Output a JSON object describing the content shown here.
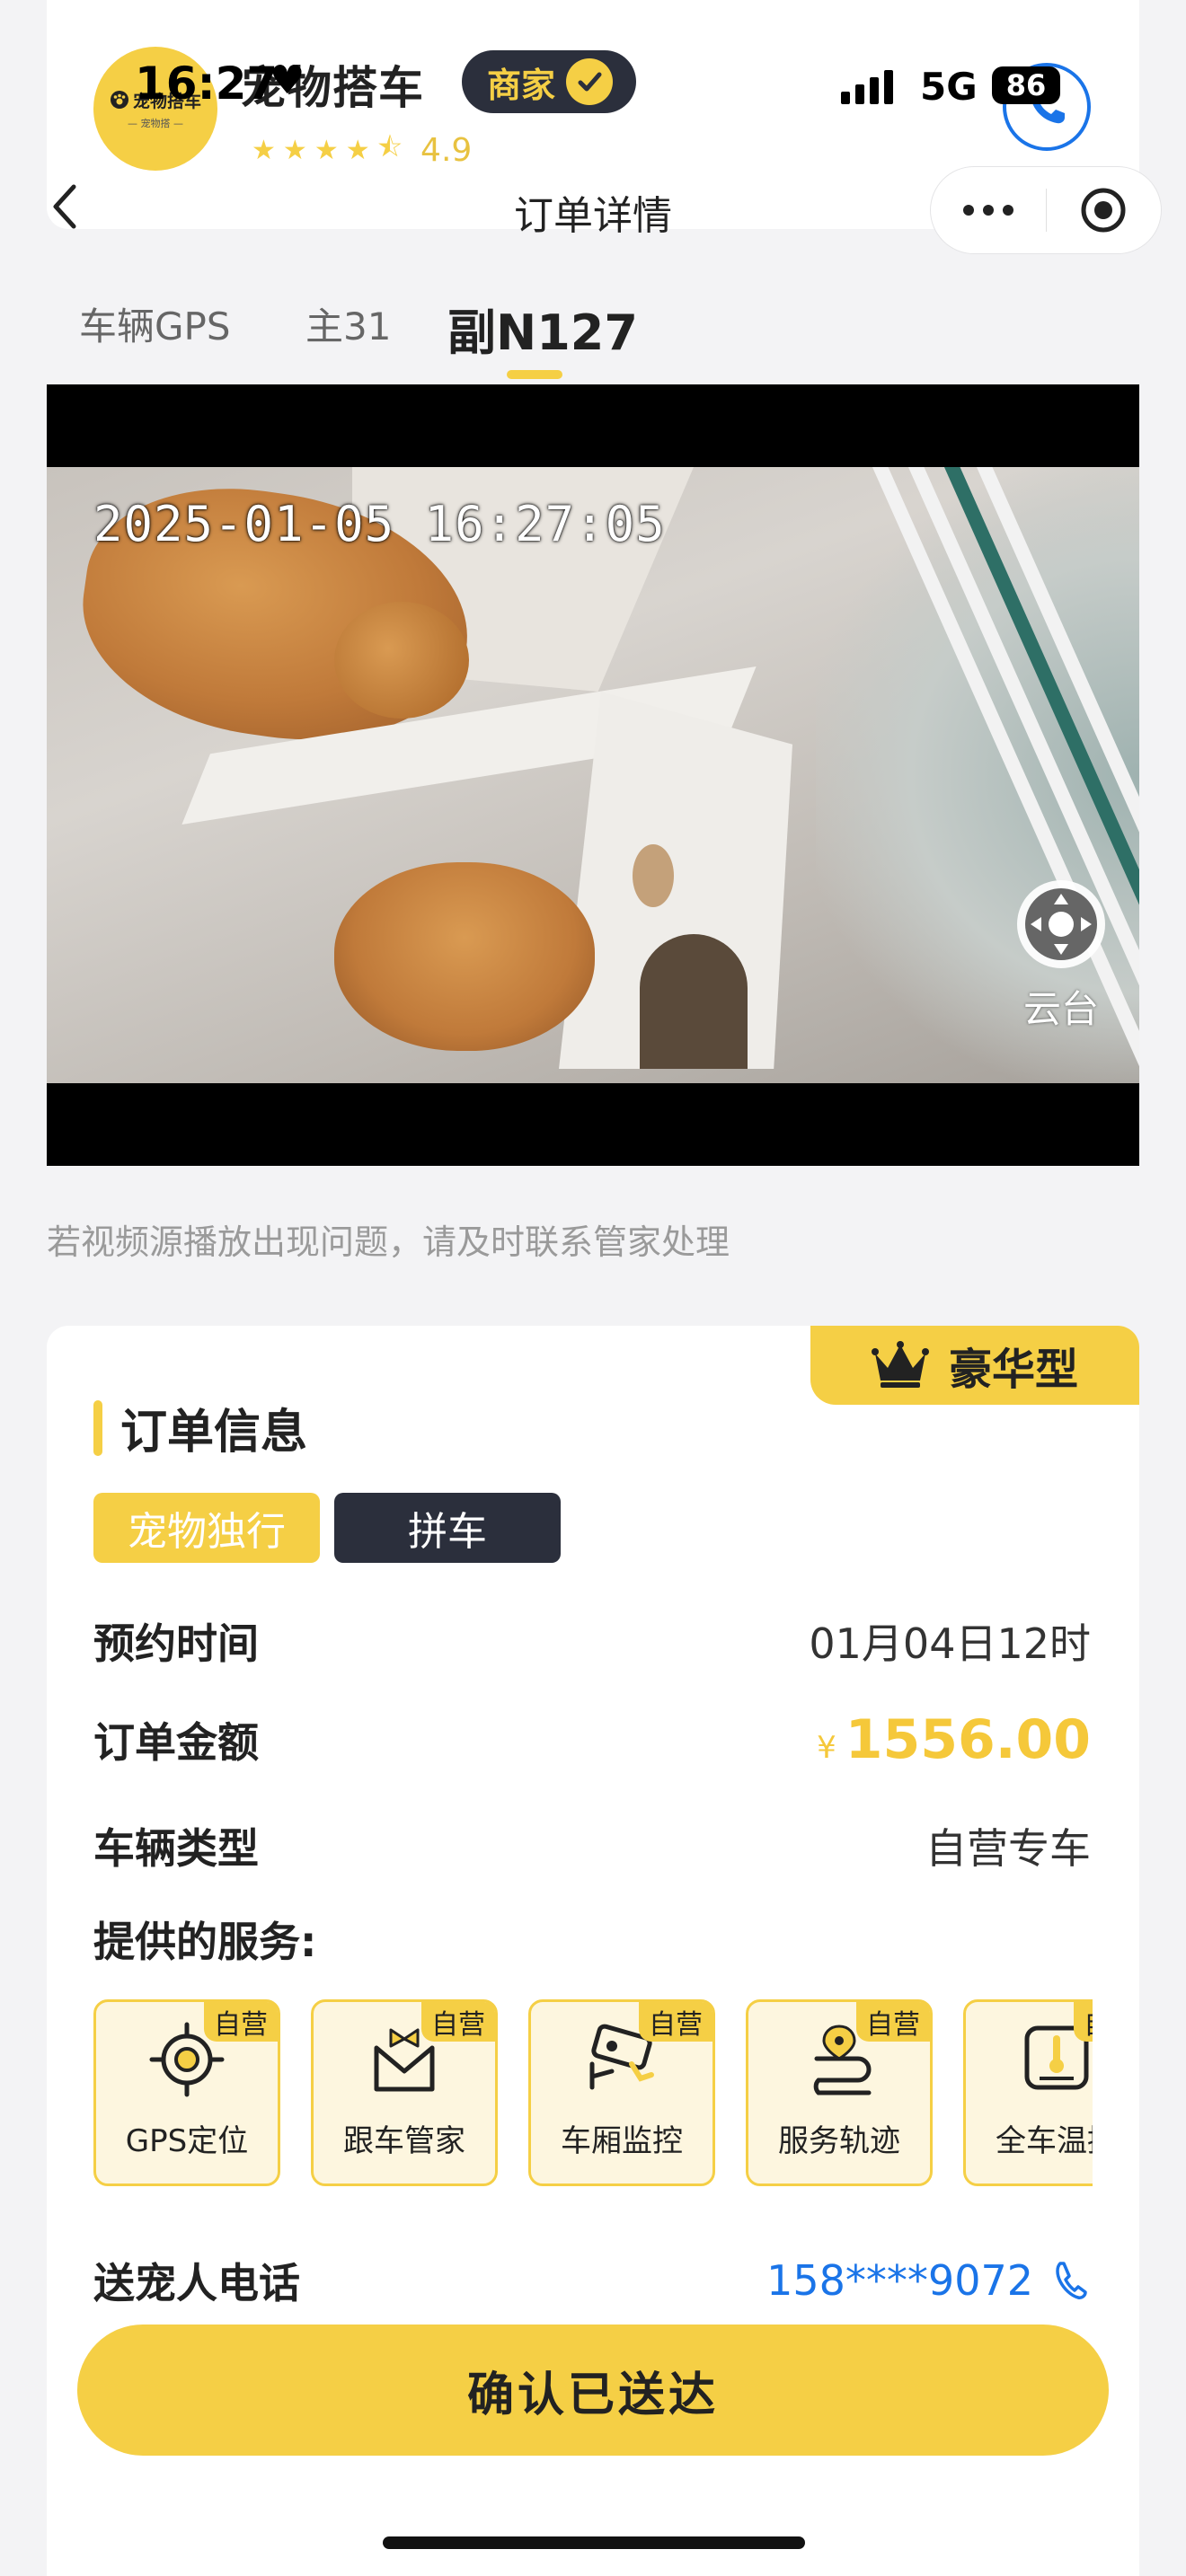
{
  "status_bar": {
    "time": "16:27",
    "network": "5G",
    "battery": "86"
  },
  "merchant": {
    "logo_text": "宠物搭车",
    "logo_sub": "— 宠物搭 —",
    "name": "宠物搭车",
    "badge": "商家",
    "rating": "4.9",
    "stars": 4.5
  },
  "nav": {
    "title": "订单详情"
  },
  "tabs": [
    {
      "label": "车辆GPS",
      "active": false
    },
    {
      "label": "主31",
      "active": false
    },
    {
      "label": "副N127",
      "active": true
    }
  ],
  "video": {
    "timestamp": "2025-01-05 16:27:05",
    "ptz_label": "云台"
  },
  "notice": "若视频源播放出现问题，请及时联系管家处理",
  "order": {
    "tier": "豪华型",
    "section_title": "订单信息",
    "tags": [
      "宠物独行",
      "拼车"
    ],
    "rows": {
      "booking_time": {
        "label": "预约时间",
        "value": "01月04日12时"
      },
      "amount": {
        "label": "订单金额",
        "currency": "¥",
        "value": "1556.00"
      },
      "vehicle_type": {
        "label": "车辆类型",
        "value": "自营专车"
      }
    },
    "services_title": "提供的服务:",
    "services": [
      {
        "name": "GPS定位",
        "badge": "自营",
        "icon": "gps-target-icon"
      },
      {
        "name": "跟车管家",
        "badge": "自营",
        "icon": "butler-icon"
      },
      {
        "name": "车厢监控",
        "badge": "自营",
        "icon": "camera-icon"
      },
      {
        "name": "服务轨迹",
        "badge": "自营",
        "icon": "route-icon"
      },
      {
        "name": "全车温控",
        "badge": "自营",
        "icon": "thermometer-icon"
      }
    ],
    "sender_phone": {
      "label": "送宠人电话",
      "value": "158****9072"
    }
  },
  "confirm_button": "确认已送达",
  "colors": {
    "accent": "#f5cf45",
    "dark": "#2b2f3c",
    "link": "#1a74e8",
    "price": "#f5c83a"
  }
}
